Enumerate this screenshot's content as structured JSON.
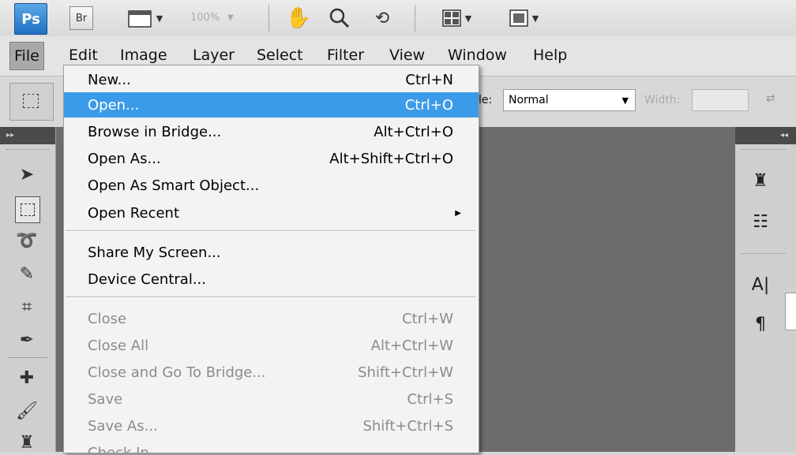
{
  "app": {
    "logo_text": "Ps",
    "bridge_label": "Br",
    "zoom_value": "100%"
  },
  "menubar": {
    "items": [
      "File",
      "Edit",
      "Image",
      "Layer",
      "Select",
      "Filter",
      "View",
      "Window",
      "Help"
    ]
  },
  "options": {
    "style_label": "le:",
    "style_value": "Normal",
    "width_label": "Width:"
  },
  "file_menu": {
    "items": [
      {
        "label": "New...",
        "shortcut": "Ctrl+N",
        "state": "enabled"
      },
      {
        "label": "Open...",
        "shortcut": "Ctrl+O",
        "state": "highlighted"
      },
      {
        "label": "Browse in Bridge...",
        "shortcut": "Alt+Ctrl+O",
        "state": "enabled"
      },
      {
        "label": "Open As...",
        "shortcut": "Alt+Shift+Ctrl+O",
        "state": "enabled"
      },
      {
        "label": "Open As Smart Object...",
        "shortcut": "",
        "state": "enabled"
      },
      {
        "label": "Open Recent",
        "shortcut": "",
        "state": "enabled",
        "submenu": true
      },
      {
        "label": "Share My Screen...",
        "shortcut": "",
        "state": "enabled"
      },
      {
        "label": "Device Central...",
        "shortcut": "",
        "state": "enabled"
      },
      {
        "label": "Close",
        "shortcut": "Ctrl+W",
        "state": "disabled"
      },
      {
        "label": "Close All",
        "shortcut": "Alt+Ctrl+W",
        "state": "disabled"
      },
      {
        "label": "Close and Go To Bridge...",
        "shortcut": "Shift+Ctrl+W",
        "state": "disabled"
      },
      {
        "label": "Save",
        "shortcut": "Ctrl+S",
        "state": "disabled"
      },
      {
        "label": "Save As...",
        "shortcut": "Shift+Ctrl+S",
        "state": "disabled"
      },
      {
        "label": "Check In...",
        "shortcut": "",
        "state": "disabled"
      }
    ]
  },
  "colors": {
    "highlight": "#3c9be8",
    "canvas": "#6c6c6c",
    "disabled_text": "#8b8b8b"
  },
  "icons": {
    "toolbar": [
      "frame-icon",
      "hand-icon",
      "zoom-icon",
      "rotate-view-icon",
      "arrange-documents-icon",
      "screen-mode-icon"
    ],
    "tools": [
      "move-icon",
      "marquee-icon",
      "lasso-icon",
      "quick-selection-icon",
      "crop-icon",
      "eyedropper-icon",
      "healing-brush-icon",
      "brush-icon",
      "clone-stamp-icon"
    ],
    "right_panels": [
      "clone-source-icon",
      "history-icon",
      "character-icon",
      "paragraph-icon"
    ]
  }
}
